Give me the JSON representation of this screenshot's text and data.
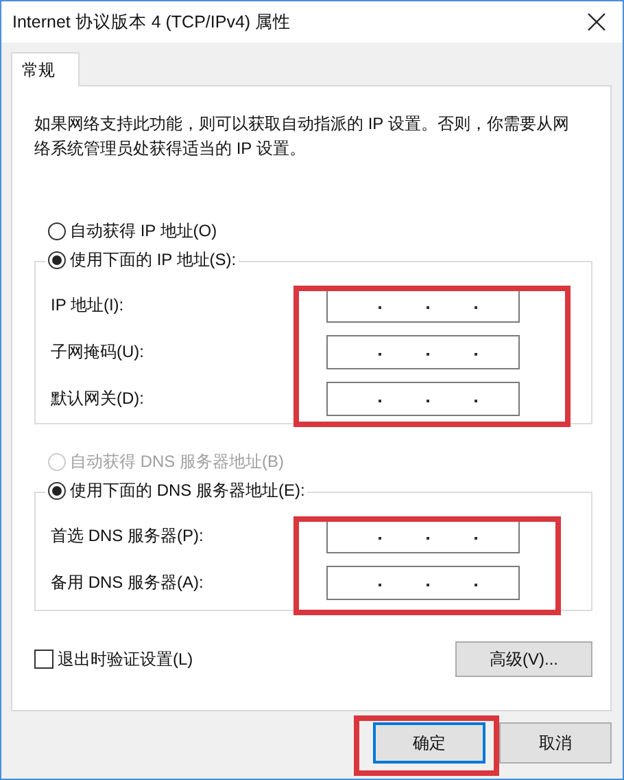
{
  "window": {
    "title": "Internet 协议版本 4 (TCP/IPv4) 属性"
  },
  "tabs": [
    {
      "label": "常规",
      "selected": true
    }
  ],
  "description": "如果网络支持此功能，则可以获取自动指派的 IP 设置。否则，你需要从网络系统管理员处获得适当的 IP 设置。",
  "ip_mode": [
    {
      "label": "自动获得 IP 地址(O)",
      "selected": false,
      "disabled": false
    },
    {
      "label": "使用下面的 IP 地址(S):",
      "selected": true,
      "disabled": false
    }
  ],
  "ip_fields": [
    {
      "label": "IP 地址(I):"
    },
    {
      "label": "子网掩码(U):"
    },
    {
      "label": "默认网关(D):"
    }
  ],
  "dns_mode": [
    {
      "label": "自动获得 DNS 服务器地址(B)",
      "selected": false,
      "disabled": true
    },
    {
      "label": "使用下面的 DNS 服务器地址(E):",
      "selected": true,
      "disabled": false
    }
  ],
  "dns_fields": [
    {
      "label": "首选 DNS 服务器(P):"
    },
    {
      "label": "备用 DNS 服务器(A):"
    }
  ],
  "validate_checkbox": {
    "label": "退出时验证设置(L)",
    "checked": false
  },
  "advanced_button": "高级(V)...",
  "buttons": [
    {
      "label": "确定",
      "focused": true
    },
    {
      "label": "取消",
      "focused": false
    }
  ],
  "annotations": [
    {
      "kind": "highlight",
      "color": "#d9363e"
    },
    {
      "kind": "highlight",
      "color": "#d9363e"
    },
    {
      "kind": "highlight",
      "color": "#d9363e"
    }
  ]
}
